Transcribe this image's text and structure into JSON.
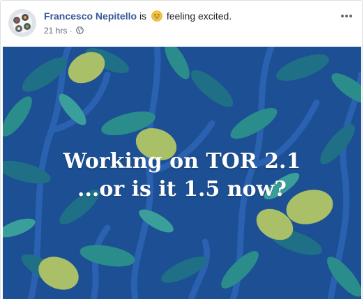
{
  "post": {
    "author": "Francesco Nepitello",
    "activity_prefix": "is",
    "activity_icon": "grinning-face-emoji-icon",
    "activity_text": "feeling excited.",
    "timestamp": "21 hrs",
    "separator": "·",
    "privacy_icon": "public-globe-icon",
    "more_icon": "more-options-icon"
  },
  "media": {
    "caption_line1": "Working on TOR 2.1",
    "caption_line2": "...or is it 1.5 now?",
    "background_color": "#1c4f93",
    "leaf_colors": [
      "#1f6f86",
      "#2b8c8c",
      "#3a9f9a"
    ],
    "lemon_color": "#a9c068"
  },
  "colors": {
    "author_link": "#385898",
    "meta_text": "#606770",
    "body_text": "#1d2129"
  }
}
